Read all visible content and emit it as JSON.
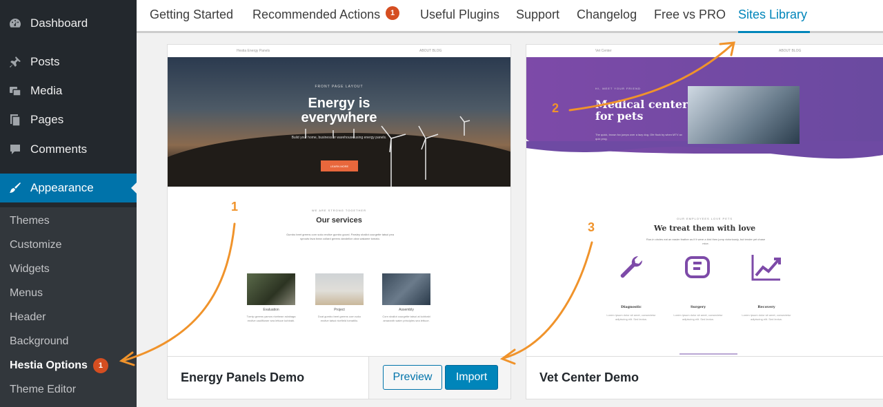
{
  "sidebar": {
    "items": [
      {
        "label": "Dashboard",
        "icon": "dashboard-icon"
      },
      {
        "label": "Posts",
        "icon": "pin-icon"
      },
      {
        "label": "Media",
        "icon": "media-icon"
      },
      {
        "label": "Pages",
        "icon": "pages-icon"
      },
      {
        "label": "Comments",
        "icon": "comment-icon"
      },
      {
        "label": "Appearance",
        "icon": "brush-icon"
      }
    ],
    "submenu": [
      "Themes",
      "Customize",
      "Widgets",
      "Menus",
      "Header",
      "Background",
      "Hestia Options",
      "Theme Editor"
    ],
    "hestia_badge": "1"
  },
  "tabs": {
    "items": [
      "Getting Started",
      "Recommended Actions",
      "Useful Plugins",
      "Support",
      "Changelog",
      "Free vs PRO",
      "Sites Library"
    ],
    "recommended_badge": "1",
    "active": "Sites Library"
  },
  "cards": [
    {
      "title": "Energy Panels Demo",
      "preview_label": "Preview",
      "import_label": "Import",
      "thumb": {
        "nav_brand": "Hestia Energy Panels",
        "nav_links": "ABOUT    BLOG",
        "hero_small": "FRONT PAGE LAYOUT",
        "hero_title_1": "Energy is",
        "hero_title_2": "everywhere",
        "hero_sub": "Build your home, business or warehouse using energy panels.",
        "hero_btn": "LEARN MORE",
        "section_small": "WE ARE STRONG TOGETHER",
        "section_title": "Our services",
        "section_text": "Gumbo beet greens corn soko endive gumbo gourd. Parsley shallot courgette tatsoi pea sprouts fava bean collard greens dandelion okra wakame tomato.",
        "services": [
          {
            "label": "Evaluation",
            "desc": "Turnip greens yarrow ricebean rutabaga endive cauliflower sea lettuce kohlrabi."
          },
          {
            "label": "Project",
            "desc": "Dcat gumbo beet greens corn soko endive tatsoi ricefield tomatillo."
          },
          {
            "label": "Assembly",
            "desc": "Corn shallot courgette tatsoi at kohlrabi amaranth water principles sea lettuce."
          }
        ]
      }
    },
    {
      "title": "Vet Center Demo",
      "thumb": {
        "nav_brand": "Vet Center",
        "nav_links": "ABOUT    BLOG",
        "hero_small": "HI, MEET YOUR FRIEND",
        "hero_title_1": "Medical center",
        "hero_title_2": "for pets",
        "hero_sub": "The quick, brown fox jumps over a lazy dog. Ofe flock by when MTV ax quiz prog.",
        "section_small": "OUR EMPLOYEES LOVE PETS",
        "section_title": "We treat them with love",
        "section_text": "Run-in circles eat an easier feather as if it were a bird then jump victoriously, but tender yet chase mice.",
        "services": [
          {
            "label": "Diagnostic",
            "desc": "Lorem ipsum dolor sit amet, consectetur adipiscing elit. Sed lectus."
          },
          {
            "label": "Surgery",
            "desc": "Lorem ipsum dolor sit amet, consectetur adipiscing elit. Sed lectus."
          },
          {
            "label": "Recovery",
            "desc": "Lorem ipsum dolor sit amet, consectetur adipiscing elit. Sed lectus."
          }
        ]
      }
    }
  ],
  "annotations": [
    "1",
    "2",
    "3"
  ],
  "colors": {
    "accent": "#0085ba",
    "annotation": "#f0932b",
    "sidebar": "#23282d",
    "active": "#0073aa",
    "badge": "#d54e21",
    "vet_purple": "#7d4aa8"
  }
}
